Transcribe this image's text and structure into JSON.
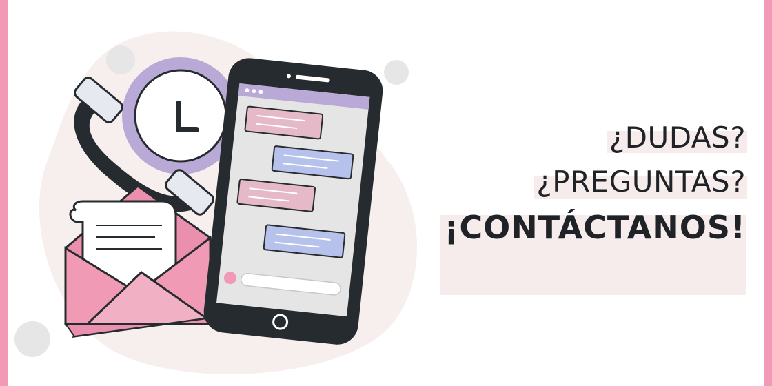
{
  "headline": {
    "line1": "¿DUDAS?",
    "line2": "¿PREGUNTAS?",
    "line3": "¡CONTÁCTANOS!"
  },
  "colors": {
    "border": "#f29ab5",
    "blob": "#f6efed",
    "phone_body": "#262b2f",
    "screen": "#e5e5e5",
    "phone_header": "#b9a9d6",
    "bubble_pink": "#e6b9c9",
    "bubble_blue": "#b7c2ec",
    "envelope": "#f09ab5",
    "clock_ring": "#b9a9d6",
    "dot_gray": "#e6e6e6",
    "highlight": "#f6ecec",
    "text": "#1f2226"
  },
  "icons": [
    "clock-icon",
    "telephone-handset-icon",
    "smartphone-icon",
    "envelope-icon",
    "letter-icon",
    "chat-bubble-icon"
  ]
}
